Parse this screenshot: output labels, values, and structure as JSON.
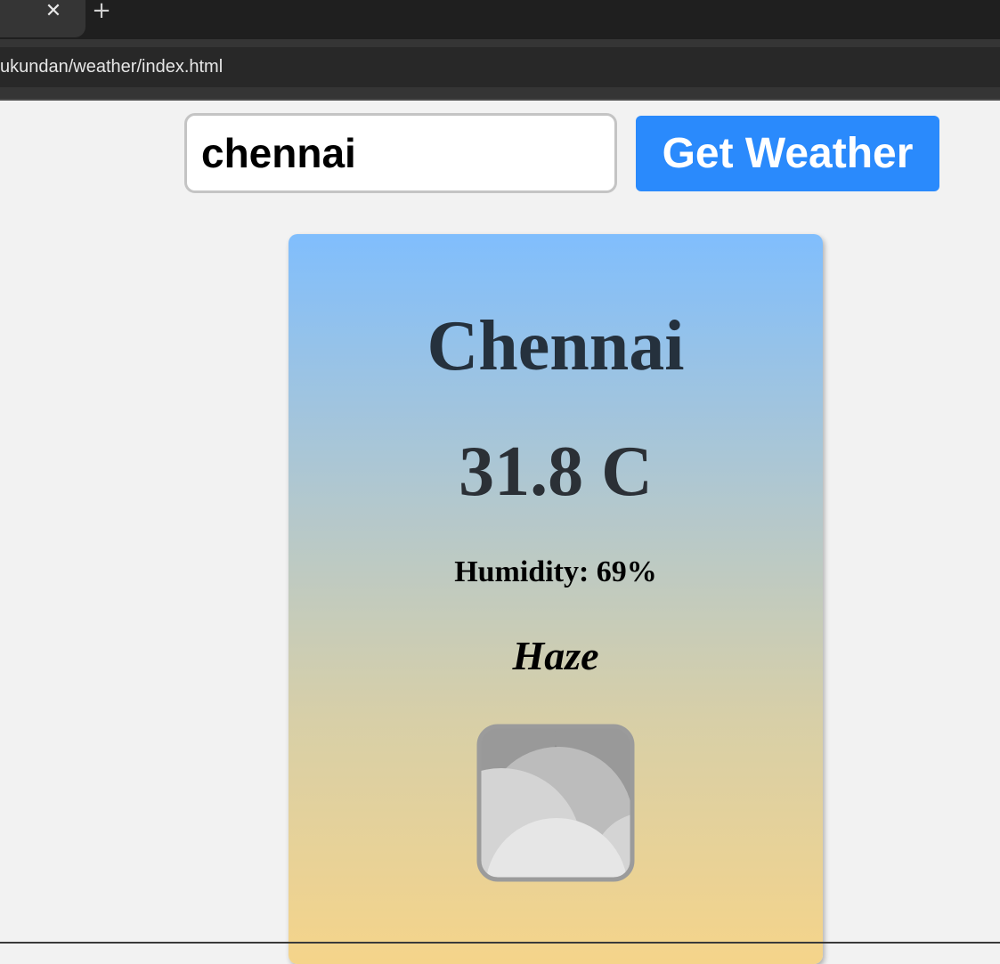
{
  "browser": {
    "tab_close_glyph": "✕",
    "new_tab_glyph": "+",
    "url": "ukundan/weather/index.html"
  },
  "search": {
    "value": "chennai",
    "button_label": "Get Weather"
  },
  "weather": {
    "city": "Chennai",
    "temperature": "31.8 C",
    "humidity": "Humidity: 69%",
    "condition": "Haze",
    "icon": "haze-cloud-icon"
  },
  "colors": {
    "button": "#2a8afc",
    "card_gradient_top": "#80befd",
    "card_gradient_bottom": "#f5d48a",
    "city_text": "#25313d"
  }
}
